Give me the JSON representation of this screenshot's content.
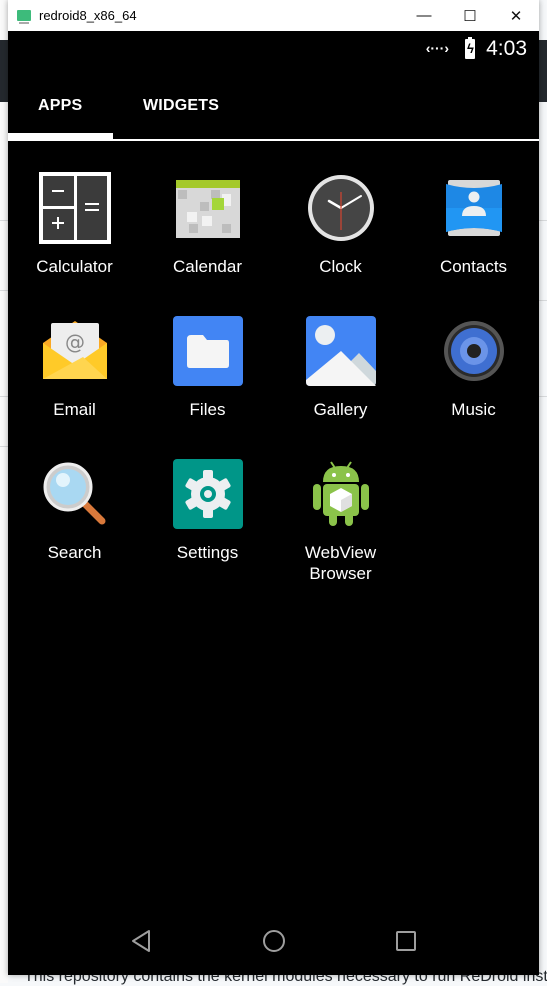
{
  "window": {
    "title": "redroid8_x86_64",
    "controls": {
      "minimize": "—",
      "maximize": "☐",
      "close": "✕"
    }
  },
  "status_bar": {
    "sync_icon": "‹···›",
    "battery_icon": "battery-charging",
    "battery_glyph": "ϟ",
    "time": "4:03"
  },
  "tabs": [
    {
      "label": "APPS",
      "selected": true
    },
    {
      "label": "WIDGETS",
      "selected": false
    }
  ],
  "apps": [
    {
      "label": "Calculator",
      "icon": "calculator-icon"
    },
    {
      "label": "Calendar",
      "icon": "calendar-icon"
    },
    {
      "label": "Clock",
      "icon": "clock-icon"
    },
    {
      "label": "Contacts",
      "icon": "contacts-icon"
    },
    {
      "label": "Email",
      "icon": "email-icon"
    },
    {
      "label": "Files",
      "icon": "files-icon"
    },
    {
      "label": "Gallery",
      "icon": "gallery-icon"
    },
    {
      "label": "Music",
      "icon": "music-icon"
    },
    {
      "label": "Search",
      "icon": "search-icon"
    },
    {
      "label": "Settings",
      "icon": "settings-icon"
    },
    {
      "label": "WebView Browser",
      "icon": "webview-browser-icon"
    }
  ],
  "nav_bar": {
    "back": "back",
    "home": "home",
    "recents": "recents"
  },
  "background": {
    "text": "This repository contains the kernel modules necessary to run ReDroid insta"
  }
}
